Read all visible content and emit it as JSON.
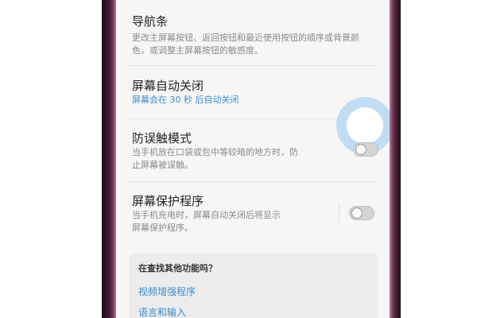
{
  "settings": {
    "items": [
      {
        "title": "导航条",
        "desc_line1": "更改主屏幕按钮、返回按钮和最近使用按钮的顺序或背景颜",
        "desc_line2": "色，或调整主屏幕按钮的敏感度。"
      },
      {
        "title": "屏幕自动关闭",
        "desc_line1": "屏幕会在 30 秒 后自动关闭"
      },
      {
        "title": "防误触模式",
        "desc_line1": "当手机放在口袋或包中等较暗的地方时，防",
        "desc_line2": "止屏幕被误触。",
        "toggle_state": "off"
      },
      {
        "title": "屏幕保护程序",
        "desc_line1": "当手机充电时，屏幕自动关闭后将显示",
        "desc_line2": "屏幕保护程序。",
        "toggle_state": "off"
      }
    ]
  },
  "suggestions": {
    "title": "在查找其他功能吗？",
    "links": [
      "视频增强程序",
      "语言和输入"
    ]
  },
  "colors": {
    "accent": "#3b8ccf",
    "highlight": "#96c8f0",
    "phone_frame": "#6a2f4c"
  }
}
